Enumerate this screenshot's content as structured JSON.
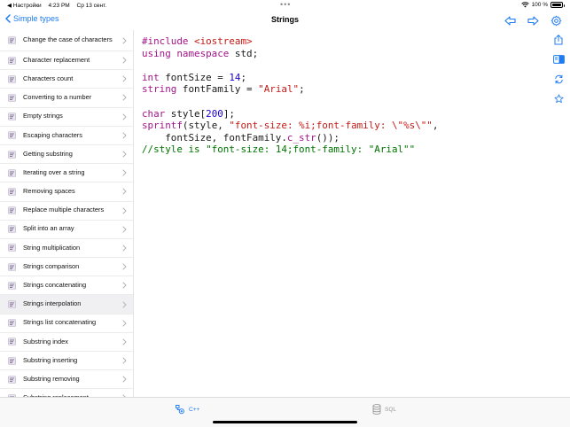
{
  "statusbar": {
    "carrier": "◀ Настройки",
    "time": "4:23 PM",
    "date": "Ср 13 сент.",
    "battery": "100 %",
    "dots": "•••"
  },
  "navbar": {
    "back_label": "Simple types",
    "title": "Strings",
    "icons": [
      "arrow-left-icon",
      "arrow-right-icon",
      "gear-icon"
    ]
  },
  "sidebar": {
    "items": [
      {
        "label": "Change the case of characters"
      },
      {
        "label": "Character replacement"
      },
      {
        "label": "Characters count"
      },
      {
        "label": "Converting to a number"
      },
      {
        "label": "Empty strings"
      },
      {
        "label": "Escaping characters"
      },
      {
        "label": "Getting substring"
      },
      {
        "label": "Iterating over a string"
      },
      {
        "label": "Removing spaces"
      },
      {
        "label": "Replace multiple characters"
      },
      {
        "label": "Split into an array"
      },
      {
        "label": "String multiplication"
      },
      {
        "label": "Strings comparison"
      },
      {
        "label": "Strings concatenating"
      },
      {
        "label": "Strings interpolation"
      },
      {
        "label": "Strings list concatenating"
      },
      {
        "label": "Substring index"
      },
      {
        "label": "Substring inserting"
      },
      {
        "label": "Substring removing"
      },
      {
        "label": "Substring replacement"
      }
    ],
    "active_index": 14
  },
  "code": {
    "lines": [
      [
        {
          "t": "#include ",
          "c": "k"
        },
        {
          "t": "<iostream>",
          "c": "r"
        }
      ],
      [
        {
          "t": "using namespace ",
          "c": "k"
        },
        {
          "t": "std;",
          "c": "t"
        }
      ],
      [],
      [
        {
          "t": "int ",
          "c": "k"
        },
        {
          "t": "fontSize = ",
          "c": "t"
        },
        {
          "t": "14",
          "c": "n"
        },
        {
          "t": ";",
          "c": "t"
        }
      ],
      [
        {
          "t": "string ",
          "c": "k"
        },
        {
          "t": "fontFamily = ",
          "c": "t"
        },
        {
          "t": "\"Arial\"",
          "c": "r"
        },
        {
          "t": ";",
          "c": "t"
        }
      ],
      [],
      [
        {
          "t": "char ",
          "c": "k"
        },
        {
          "t": "style[",
          "c": "t"
        },
        {
          "t": "200",
          "c": "n"
        },
        {
          "t": "];",
          "c": "t"
        }
      ],
      [
        {
          "t": "sprintf",
          "c": "k"
        },
        {
          "t": "(style, ",
          "c": "t"
        },
        {
          "t": "\"font-size: %i;font-family: \\\"%s\\\"\"",
          "c": "r"
        },
        {
          "t": ",",
          "c": "t"
        }
      ],
      [
        {
          "t": "    fontSize, fontFamily.",
          "c": "t"
        },
        {
          "t": "c_str",
          "c": "k"
        },
        {
          "t": "());",
          "c": "t"
        }
      ],
      [
        {
          "t": "//style is \"font-size: 14;font-family: \"Arial\"\"",
          "c": "c"
        }
      ]
    ]
  },
  "tools": [
    "share-icon",
    "sidebar-toggle-icon",
    "refresh-icon",
    "star-icon"
  ],
  "tabbar": {
    "tabs": [
      {
        "label": "C++",
        "icon": "cpp-icon",
        "active": true
      },
      {
        "label": "SQL",
        "icon": "database-icon",
        "active": false
      }
    ]
  },
  "colors": {
    "accent": "#1e7bf2",
    "keyword": "#a4158b",
    "string": "#c41a16",
    "number": "#1c00cf",
    "comment": "#007400"
  }
}
